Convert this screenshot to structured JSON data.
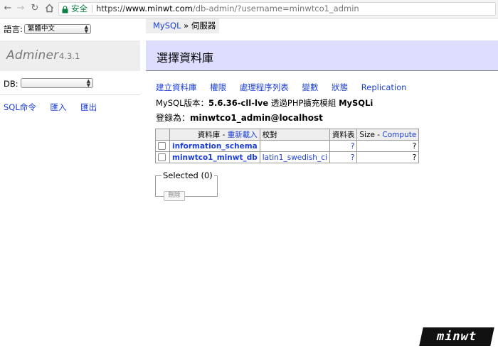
{
  "browser": {
    "secure_label": "安全",
    "url_scheme": "https://",
    "url_host": "www.minwt.com",
    "url_path": "/db-admin/?username=minwtco1_admin"
  },
  "sidebar": {
    "lang_label": "語言:",
    "lang_value": "繁體中文",
    "app_name": "Adminer",
    "app_version": "4.3.1",
    "db_label": "DB:",
    "db_value": "",
    "links": [
      "SQL命令",
      "匯入",
      "匯出"
    ]
  },
  "breadcrumb": {
    "system": "MySQL",
    "separator": " » ",
    "current": "伺服器"
  },
  "page": {
    "title": "選擇資料庫",
    "links": [
      "建立資料庫",
      "權限",
      "處理程序列表",
      "變數",
      "狀態",
      "Replication"
    ],
    "version_label": "MySQL版本：",
    "version_value": "5.6.36-cll-lve",
    "via_label": " 透過PHP擴充模組 ",
    "extension": "MySQLi",
    "login_label": "登錄為：",
    "login_value": "minwtco1_admin@localhost"
  },
  "table": {
    "col_database": "資料庫",
    "col_dash": " - ",
    "col_refresh": "重新載入",
    "col_collation": "校對",
    "col_tables": "資料表",
    "col_size": "Size",
    "col_compute": "Compute",
    "rows": [
      {
        "name": "information_schema",
        "collation": "",
        "tables": "?",
        "size": "?"
      },
      {
        "name": "minwtco1_minwt_db",
        "collation": "latin1_swedish_ci",
        "tables": "?",
        "size": "?"
      }
    ]
  },
  "selected": {
    "legend": "Selected (0)",
    "delete_label": "刪除"
  },
  "watermark": "minwt"
}
